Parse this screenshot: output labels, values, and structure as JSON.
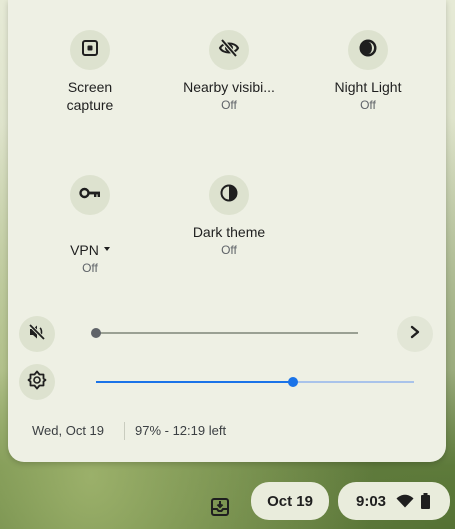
{
  "quick_settings": {
    "tiles": [
      {
        "label": "Screen\ncapture",
        "sub": "",
        "icon": "screen-capture-icon"
      },
      {
        "label": "Nearby visibi...",
        "sub": "Off",
        "icon": "eye-off-icon"
      },
      {
        "label": "Night Light",
        "sub": "Off",
        "icon": "night-light-icon"
      },
      {
        "label": "VPN",
        "sub": "Off",
        "icon": "vpn-key-icon"
      },
      {
        "label": "Dark theme",
        "sub": "Off",
        "icon": "dark-theme-icon"
      }
    ],
    "volume": {
      "icon": "volume-muted-icon",
      "level": 0
    },
    "brightness": {
      "icon": "brightness-icon",
      "level": 0.62
    },
    "footer": {
      "date": "Wed, Oct 19",
      "battery": "97% - 12:19 left"
    }
  },
  "shelf": {
    "date": "Oct 19",
    "time": "9:03"
  },
  "colors": {
    "accent": "#1a73e8",
    "panel_bg": "#eef0e4",
    "tile_bg": "#dde2cf"
  }
}
